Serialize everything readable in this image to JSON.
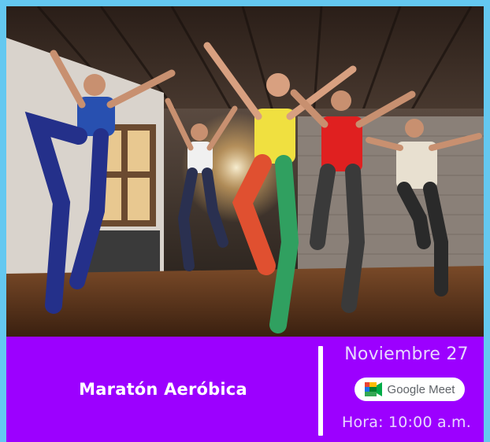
{
  "photo": {
    "subject": "dance-class-photo"
  },
  "event": {
    "title": "Maratón Aeróbica",
    "date": "Noviembre 27",
    "platform": "Google Meet",
    "time": "Hora: 10:00 a.m."
  },
  "colors": {
    "background": "#64c8f0",
    "banner": "#9c00ff",
    "text": "#ffffff",
    "date_text": "#e8d8ff",
    "pill": "#ffffff"
  },
  "icons": {
    "meet": "google-meet-icon"
  }
}
